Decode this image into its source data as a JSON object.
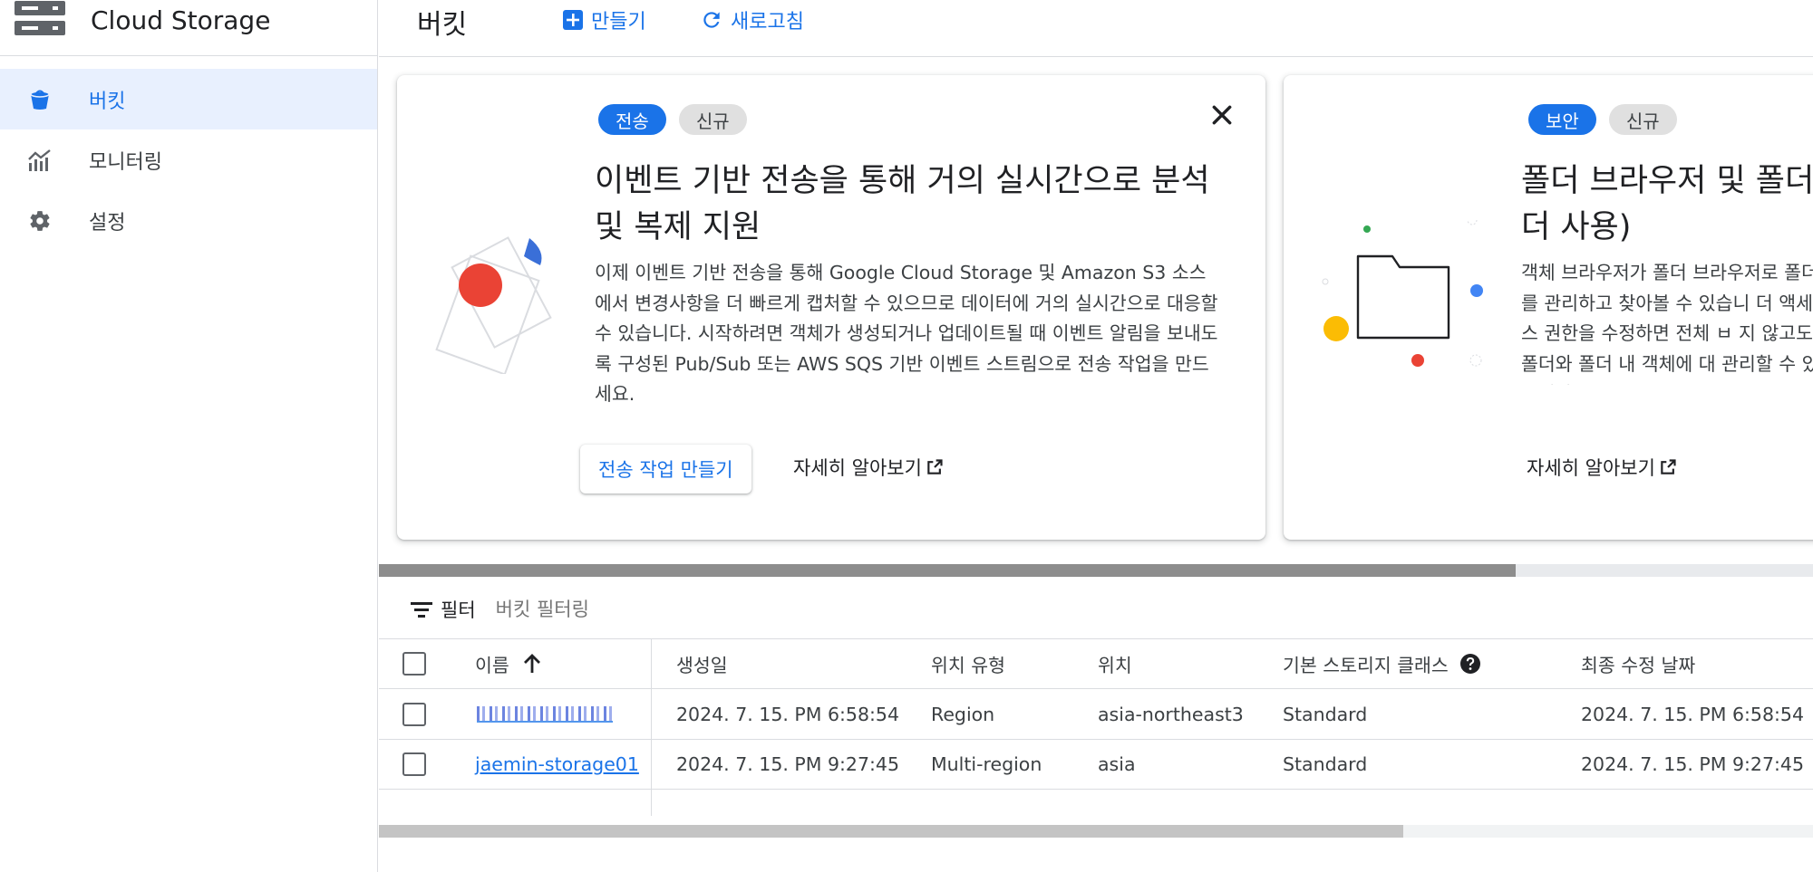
{
  "app": {
    "title": "Cloud Storage",
    "icon": "storage-server-icon"
  },
  "sidebar": {
    "items": [
      {
        "label": "버킷",
        "icon": "bucket-icon",
        "active": true
      },
      {
        "label": "모니터링",
        "icon": "chart-icon",
        "active": false
      },
      {
        "label": "설정",
        "icon": "gear-icon",
        "active": false
      }
    ]
  },
  "header": {
    "title": "버킷",
    "create_label": "만들기",
    "refresh_label": "새로고침"
  },
  "cards": [
    {
      "chips": [
        "전송",
        "신규"
      ],
      "title": "이벤트 기반 전송을 통해 거의 실시간으로 분석 및 복제 지원",
      "description": "이제 이벤트 기반 전송을 통해 Google Cloud Storage 및 Amazon S3 소스에서 변경사항을 더 빠르게 캡처할 수 있으므로 데이터에 거의 실시간으로 대응할 수 있습니다. 시작하려면 객체가 생성되거나 업데이트될 때 이벤트 알림을 보내도록 구성된 Pub/Sub 또는 AWS SQS 기반 이벤트 스트림으로 전송 작업을 만드세요.",
      "primary_label": "전송 작업 만들기",
      "learn_more": "자세히 알아보기"
    },
    {
      "chips": [
        "보안",
        "신규"
      ],
      "title": "폴더 브라우저 및 폴더 더 사용)",
      "description": "객체 브라우저가 폴더 브라우저로 폴더를 관리하고 찾아볼 수 있습니 더 액세스 권한을 수정하면 전체 ㅂ 지 않고도 폴더와 폴더 내 객체에 대 관리할 수 있습니다.",
      "learn_more": "자세히 알아보기"
    }
  ],
  "filter": {
    "label": "필터",
    "placeholder": "버킷 필터링"
  },
  "table": {
    "columns": [
      "이름",
      "생성일",
      "위치 유형",
      "위치",
      "기본 스토리지 클래스",
      "최종 수정 날짜"
    ],
    "sort_icon": "arrow-up-icon",
    "help_icon": "help-icon",
    "rows": [
      {
        "name": "",
        "created": "2024. 7. 15. PM 6:58:54",
        "location_type": "Region",
        "location": "asia-northeast3",
        "storage_class": "Standard",
        "modified": "2024. 7. 15. PM 6:58:54"
      },
      {
        "name": "jaemin-storage01",
        "created": "2024. 7. 15. PM 9:27:45",
        "location_type": "Multi-region",
        "location": "asia",
        "storage_class": "Standard",
        "modified": "2024. 7. 15. PM 9:27:45"
      }
    ]
  },
  "colors": {
    "accent": "#1a73e8",
    "active_bg": "#e8f0fe"
  }
}
